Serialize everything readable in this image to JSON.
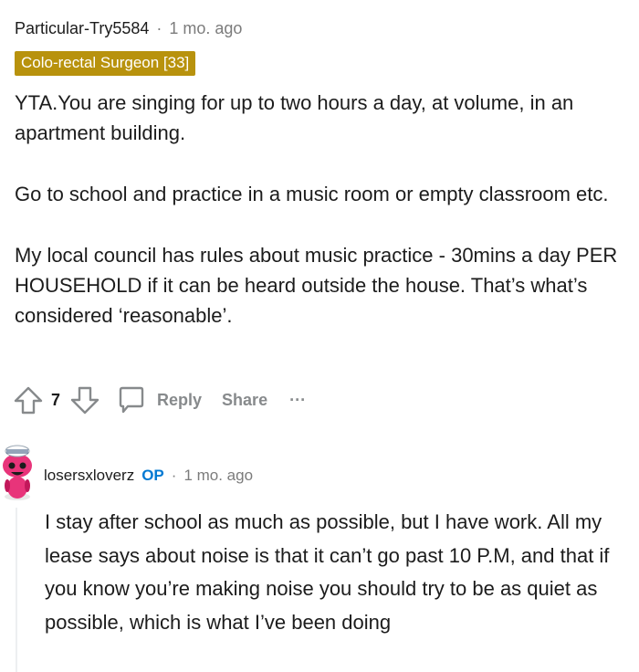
{
  "comment1": {
    "username": "Particular-Try5584",
    "separator": "·",
    "time": "1 mo. ago",
    "flair": "Colo-rectal Surgeon [33]",
    "flair_color": "#b8920d",
    "paragraphs": [
      "YTA.You are singing for up to two hours a day, at volume, in an apartment building.",
      "Go to school and practice in a music room or empty classroom etc.",
      "My local council has rules about music practice - 30mins a day PER HOUSEHOLD if it can be heard outside the house. That’s what’s considered ‘reasonable’."
    ],
    "actions": {
      "upvote_icon": "upvote-arrow-icon",
      "vote_count": "7",
      "downvote_icon": "downvote-arrow-icon",
      "reply_icon": "speech-bubble-icon",
      "reply_label": "Reply",
      "share_label": "Share",
      "more_label": "···"
    }
  },
  "comment2": {
    "avatar_icon": "snoo-avatar-icon",
    "username": "losersxloverz",
    "op_badge": "OP",
    "op_color": "#0079d3",
    "separator": "·",
    "time": "1 mo. ago",
    "body": "I stay after school as much as possible, but I have work. All my lease says about noise is that it can’t go past 10 P.M, and that if you know you’re making noise you should try to be as quiet as possible, which is what I’ve been doing"
  }
}
